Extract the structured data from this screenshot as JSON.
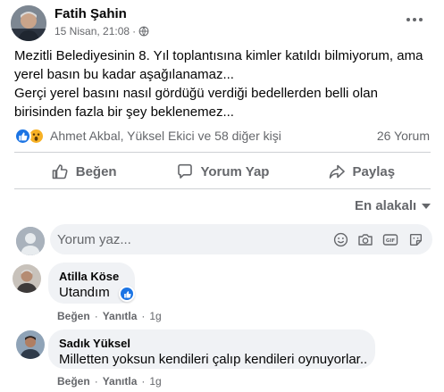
{
  "post": {
    "author": "Fatih Şahin",
    "date": "15 Nisan, 21:08",
    "separator": "·",
    "lines": [
      "Mezitli Belediyesinin 8. Yıl toplantısına kimler katıldı bilmiyorum, ama",
      "yerel basın bu kadar aşağılanamaz...",
      "Gerçi yerel basını nasıl gördüğü verdiği bedellerden belli olan",
      "birisinden fazla bir şey beklenemez..."
    ]
  },
  "reactions": {
    "types": [
      "like-icon",
      "wow-icon"
    ],
    "summary": "Ahmet Akbal, Yüksel Ekici ve 58 diğer kişi",
    "comment_count": "26 Yorum"
  },
  "actions": {
    "like": "Beğen",
    "comment": "Yorum Yap",
    "share": "Paylaş"
  },
  "sort": {
    "label": "En alakalı"
  },
  "composer": {
    "placeholder": "Yorum yaz..."
  },
  "comments": [
    {
      "author": "Atilla Köse",
      "text": "Utandım",
      "like_label": "Beğen",
      "reply_label": "Yanıtla",
      "separator": "·",
      "time": "1g"
    },
    {
      "author": "Sadık Yüksel",
      "text": "Milletten yoksun kendileri çalıp kendileri oynuyorlar..",
      "like_label": "Beğen",
      "reply_label": "Yanıtla",
      "separator": "·",
      "time": "1g"
    }
  ],
  "colors": {
    "accent": "#1b74e4",
    "secondary_text": "#65676b",
    "bubble": "#f0f2f5"
  }
}
